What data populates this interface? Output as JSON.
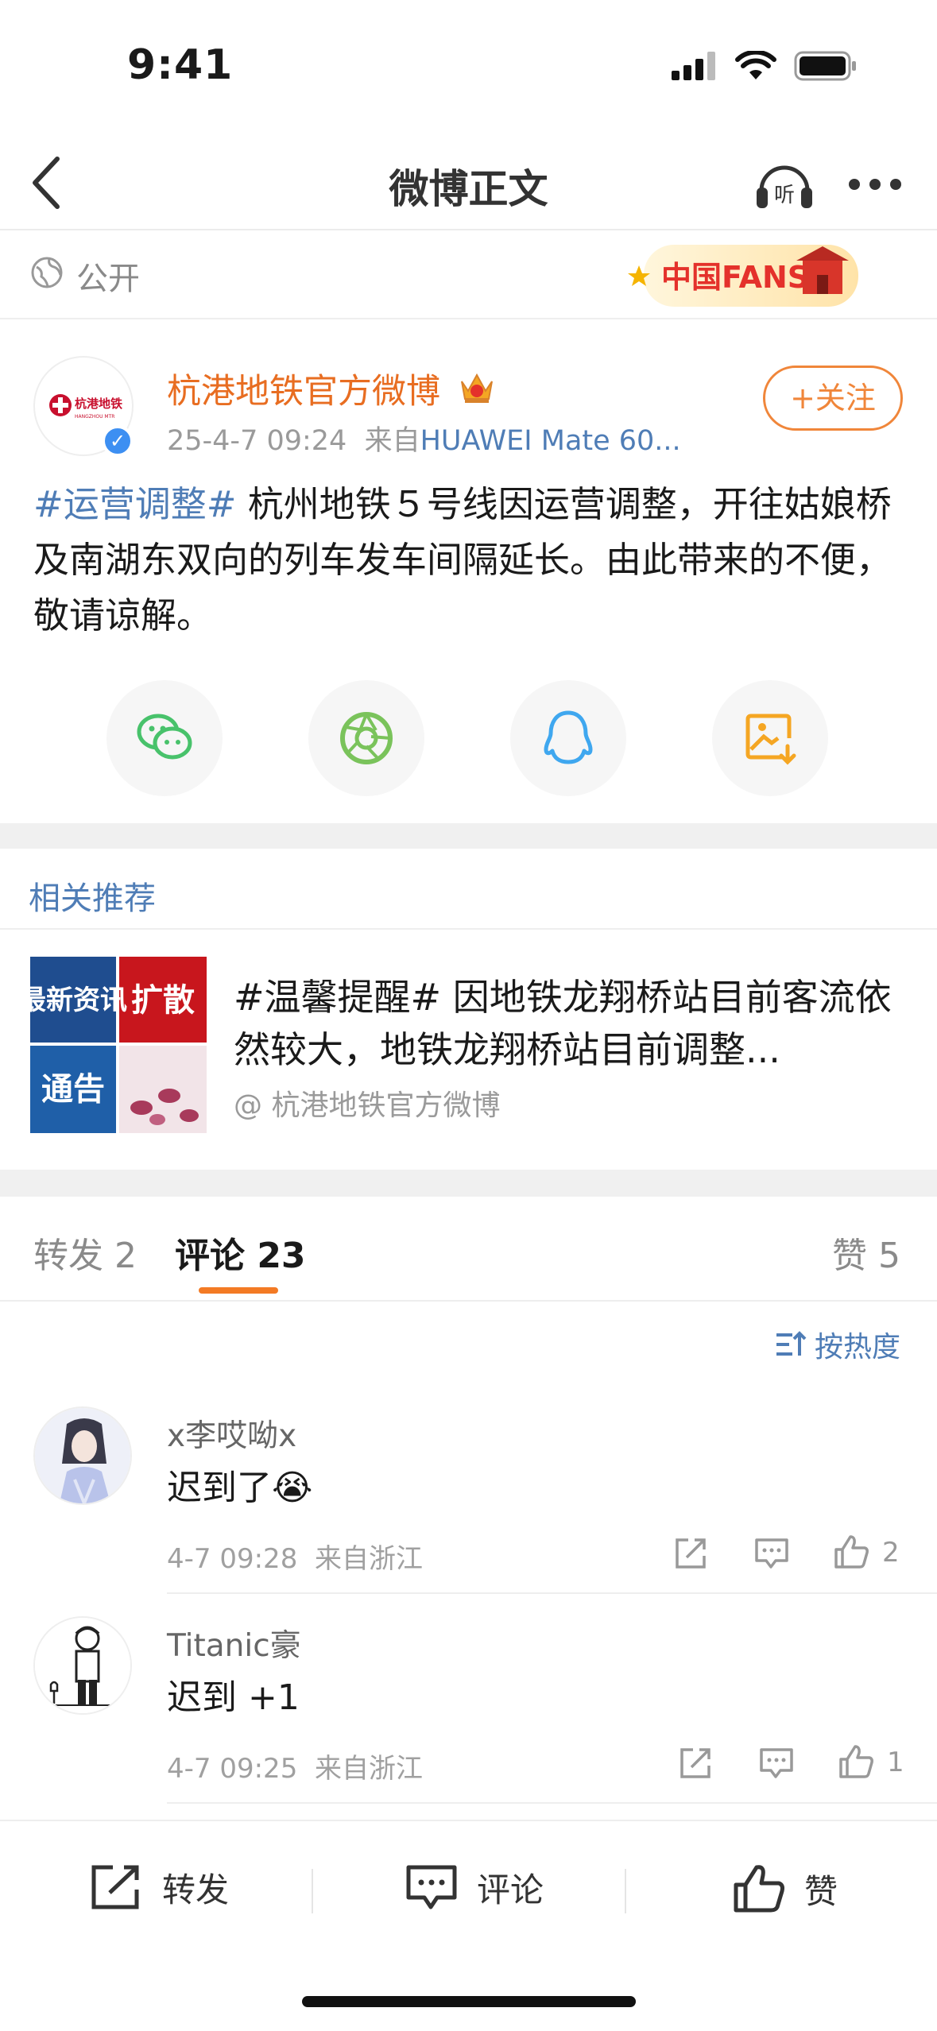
{
  "status_bar": {
    "time": "9:41"
  },
  "nav": {
    "title": "微博正文"
  },
  "visibility": {
    "label": "公开"
  },
  "post": {
    "author": "杭港地铁官方微博",
    "date": "25-4-7 09:24",
    "source_prefix": "来自",
    "device": "HUAWEI Mate 60...",
    "follow_label": "+关注",
    "hashtag": "#运营调整#",
    "text": " 杭州地铁５号线因运营调整，开往姑娘桥及南湖东双向的列车发车间隔延长。由此带来的不便，敬请谅解。",
    "avatar_text": "杭港地铁",
    "avatar_sub": "HANGZHOU MTR"
  },
  "share_icons": [
    "wechat-icon",
    "moments-icon",
    "qq-icon",
    "save-image-icon"
  ],
  "related": {
    "header": "相关推荐",
    "thumb_labels": [
      "最新资讯",
      "扩散",
      "通告"
    ],
    "title": "#温馨提醒# 因地铁龙翔桥站目前客流依然较大，地铁龙翔桥站目前调整...",
    "source": "@ 杭港地铁官方微博"
  },
  "tabs": {
    "reposts": "转发 2",
    "comments": "评论 23",
    "likes": "赞 5",
    "sort": "按热度"
  },
  "comments": [
    {
      "name": "x李哎呦x",
      "text": "迟到了😭",
      "time": "4-7 09:28",
      "location": "来自浙江",
      "likes": "2"
    },
    {
      "name": "Titanic豪",
      "text": "迟到 +1",
      "time": "4-7 09:25",
      "location": "来自浙江",
      "likes": "1"
    }
  ],
  "bottom_bar": {
    "repost": "转发",
    "comment": "评论",
    "like": "赞"
  },
  "colors": {
    "accent": "#f37a24",
    "link": "#4f7db6",
    "author": "#e86d21"
  }
}
